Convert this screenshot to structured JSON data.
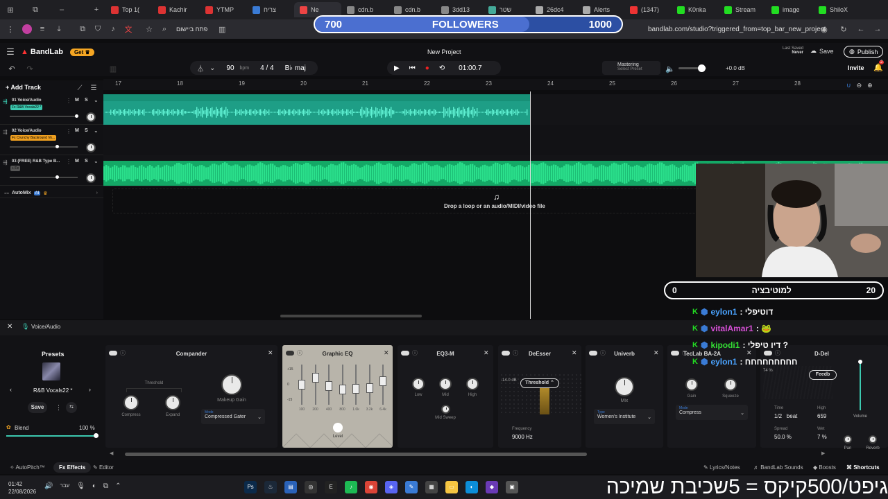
{
  "browser": {
    "tabs": [
      "Top 1(",
      "Kachir",
      "YTMP",
      "צריח",
      "Ne",
      "cdn.b",
      "cdn.b",
      "3dd13",
      "שטר",
      "26dc4",
      "Alerts",
      "(1347)",
      "K0nka",
      "Stream",
      "image",
      "ShiloX"
    ],
    "tab_colors": [
      "#d33",
      "#d33",
      "#d33",
      "#3a7bd5",
      "#e44",
      "#888",
      "#888",
      "#888",
      "#4a9",
      "#aaa",
      "#aaa",
      "#e33",
      "#2d2",
      "#2d2",
      "#2d2",
      "#2d2"
    ],
    "url": "bandlab.com/studio?triggered_from=top_bar_new_project",
    "hebrew_button": "פתח ביישום"
  },
  "overlay": {
    "followers_left": "700",
    "followers_label": "FOLLOWERS",
    "followers_right": "1000",
    "followers_progress": 0.7,
    "motivation_left": "0",
    "motivation_label": "למוטיבציה",
    "motivation_right": "20",
    "chat": [
      {
        "user": "eylon1",
        "msg": ": דוטיפלי",
        "color": "#4aa3ff"
      },
      {
        "user": "vitalAmar1",
        "msg": ": 🐸",
        "color": "#d64fd6"
      },
      {
        "user": "kipodi1",
        "msg": ": דיו טיפלי ?",
        "color": "#33dd33"
      },
      {
        "user": "eylon1",
        "msg": ": חחחחחחחחח",
        "color": "#4aa3ff"
      }
    ],
    "bottom_text": "גיפט/500קיקס = 5שכיבת שמיכה"
  },
  "header": {
    "logo": "BandLab",
    "get_label": "Get",
    "project_title": "New Project",
    "last_saved_label": "Last Saved",
    "last_saved_value": "Never",
    "save_label": "Save",
    "publish_label": "Publish",
    "invite_label": "Invite",
    "notif_count": "2"
  },
  "transport": {
    "bpm": "90",
    "bpm_unit": "bpm",
    "time_sig": "4 / 4",
    "key": "maj",
    "time": "01:00.7",
    "mastering_label": "Mastering",
    "mastering_sub": "Select Preset",
    "volume_db": "+0.0 dB"
  },
  "tracks": {
    "add_label": "Add Track",
    "items": [
      {
        "name": "01 Voice/Audio",
        "fx": "Fx R&B Vocals22 *",
        "fx_color": "#3cc9b0"
      },
      {
        "name": "02 Voice/Audio",
        "fx": "Fx Crunchy Backround Vo...",
        "fx_color": "#f0a020"
      },
      {
        "name": "03 (FREE) R&B Type B...",
        "fx": "+ Fx",
        "fx_color": "#555"
      }
    ],
    "automix_label": "AutoMix",
    "ai_badge": "AI"
  },
  "timeline": {
    "bars": [
      "17",
      "18",
      "19",
      "20",
      "21",
      "22",
      "23",
      "24",
      "25",
      "26",
      "27",
      "28"
    ],
    "drop_hint": "Drop a loop or an audio/MIDI/video file"
  },
  "panel": {
    "track_label": "Voice/Audio",
    "presets_label": "Presets",
    "preset_name": "R&B Vocals22 *",
    "save_label": "Save",
    "blend_label": "Blend",
    "blend_value": "100 %",
    "blend_progress": 1.0
  },
  "effects": {
    "compander": {
      "title": "Compander",
      "threshold": "Threshold",
      "compress": "Compress",
      "expand": "Expand",
      "makeup": "Makeup Gain",
      "mode_label": "Mode",
      "mode": "Compressed Gater"
    },
    "geq": {
      "title": "Graphic EQ",
      "scale": [
        "+15",
        "0",
        "-15"
      ],
      "bands": [
        "100",
        "200",
        "400",
        "800",
        "1.6k",
        "3.2k",
        "6.4k"
      ],
      "level": "Level"
    },
    "eq3": {
      "title": "EQ3-M",
      "low": "Low",
      "mid": "Mid",
      "high": "High",
      "sweep": "Mid Sweep"
    },
    "deesser": {
      "title": "DeEsser",
      "db": "-14.0 dB",
      "threshold": "Threshold",
      "freq_label": "Frequency",
      "freq": "9000 Hz"
    },
    "univerb": {
      "title": "Univerb",
      "mix": "Mix",
      "type_label": "Type",
      "type": "Women's Institute"
    },
    "teclab": {
      "title": "TecLab BA-2A",
      "gain": "Gain",
      "squeeze": "Squeeze",
      "mode_label": "Mode",
      "mode": "Compress"
    },
    "delay": {
      "title": "D-Del",
      "pct": "74 %",
      "feedback": "Feedb",
      "time_label": "Time",
      "time": "1/2",
      "beat": "beat",
      "high_label": "High",
      "high": "659",
      "spread_label": "Spread",
      "spread": "50.0 %",
      "wet_label": "Wet",
      "wet": "7 %",
      "volume": "Volume",
      "pan": "Pan",
      "reverb": "Reverb"
    }
  },
  "bottombar": {
    "autopitch": "AutoPitch™",
    "effects": "Effects",
    "editor": "Editor",
    "lyrics": "Lyrics/Notes",
    "sounds": "BandLab Sounds",
    "boosts": "Boosts",
    "shortcuts": "Shortcuts"
  },
  "taskbar": {
    "time": "01:42",
    "date": "22/08/2026",
    "lang": "עבר"
  }
}
